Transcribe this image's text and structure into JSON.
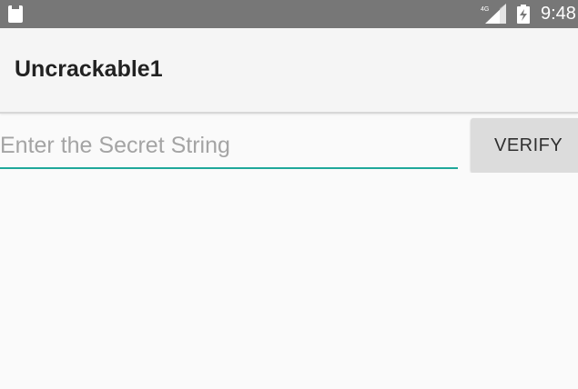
{
  "status_bar": {
    "time": "9:48",
    "network_type": "4G",
    "icons": [
      "sd-card-icon",
      "signal-icon",
      "battery-icon"
    ]
  },
  "app_bar": {
    "title": "Uncrackable1"
  },
  "form": {
    "placeholder": "Enter the Secret String",
    "value": "",
    "verify_label": "VERIFY"
  },
  "colors": {
    "status_bar": "#777777",
    "app_bar": "#f5f5f5",
    "background": "#fafafa",
    "accent": "#1fa89a",
    "button": "#dcdcdc",
    "title_text": "#222222"
  }
}
